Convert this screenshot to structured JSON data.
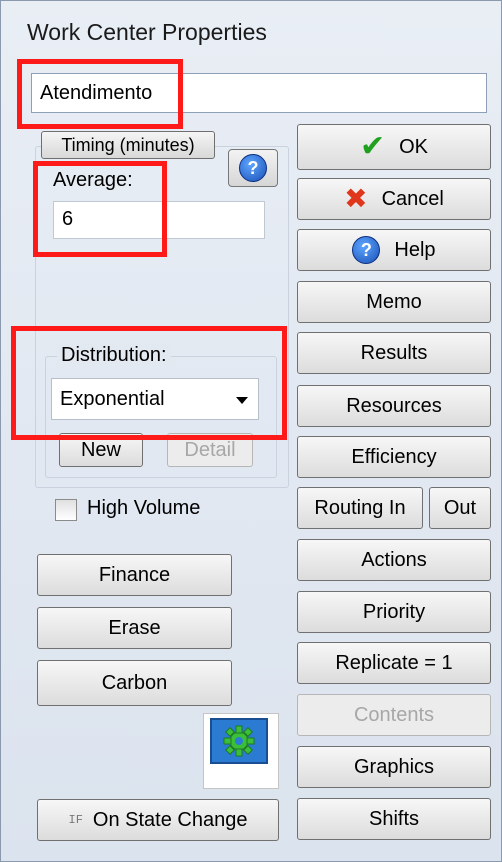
{
  "window": {
    "title": "Work Center Properties"
  },
  "name_field": {
    "value": "Atendimento"
  },
  "timing": {
    "tab_label": "Timing (minutes)",
    "average_label": "Average:",
    "average_value": "6",
    "distribution_label": "Distribution:",
    "distribution_value": "Exponential",
    "new_label": "New",
    "detail_label": "Detail",
    "high_volume_label": "High Volume",
    "high_volume_checked": false
  },
  "left_buttons": {
    "finance": "Finance",
    "erase": "Erase",
    "carbon": "Carbon",
    "on_state_change": "On State Change",
    "if_icon_text": "IF"
  },
  "right_buttons": {
    "ok": "OK",
    "cancel": "Cancel",
    "help": "Help",
    "memo": "Memo",
    "results": "Results",
    "resources": "Resources",
    "efficiency": "Efficiency",
    "routing_in": "Routing In",
    "out": "Out",
    "actions": "Actions",
    "priority": "Priority",
    "replicate": "Replicate = 1",
    "contents": "Contents",
    "graphics": "Graphics",
    "shifts": "Shifts"
  },
  "icons": {
    "help_question": "help-icon",
    "ok_check": "check-icon",
    "cancel_x": "x-icon",
    "graphic_gear": "gear-icon"
  },
  "colors": {
    "highlight_box": "#ff1a1a",
    "ok_check": "#1fa11f",
    "cancel_x": "#e0361b",
    "help_blue": "#1a4fb5"
  }
}
